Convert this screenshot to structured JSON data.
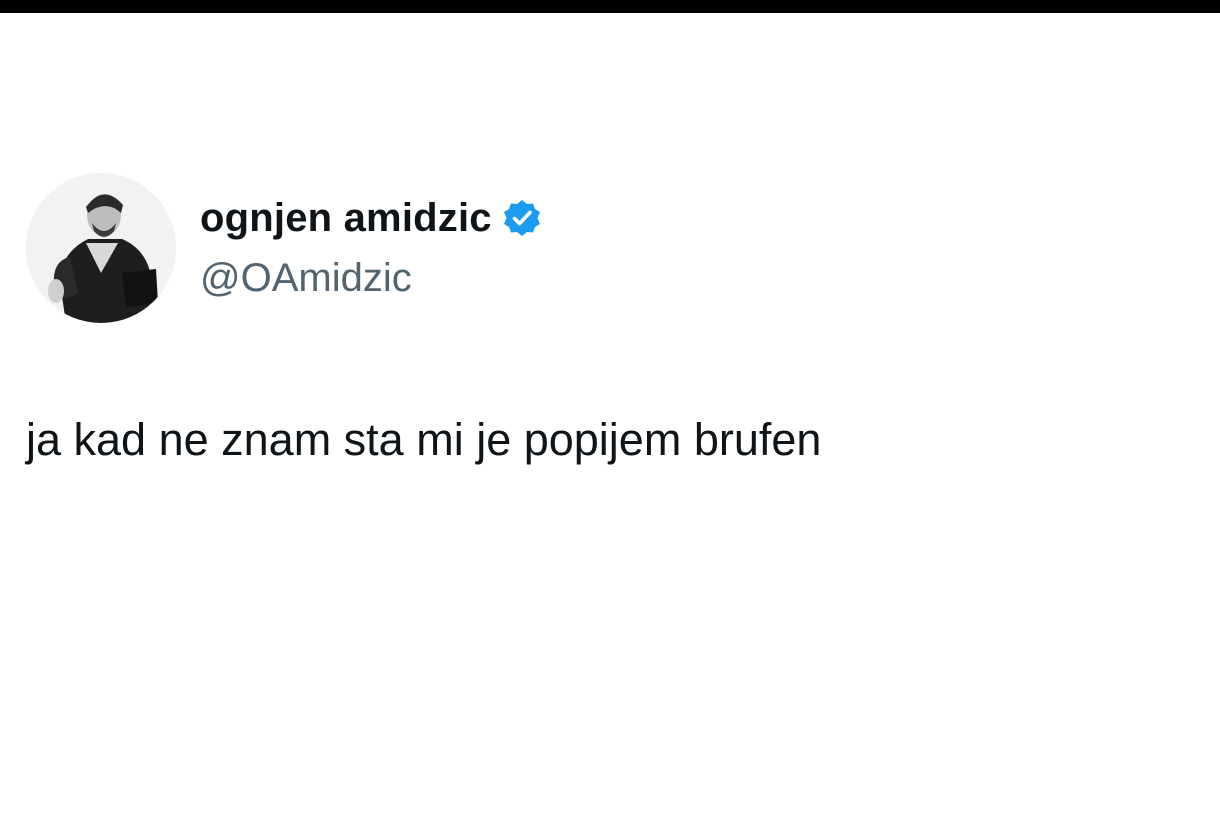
{
  "tweet": {
    "author": {
      "display_name": "ognjen amidzic",
      "handle": "@OAmidzic",
      "verified": true,
      "verified_badge_icon": "verified-badge-icon",
      "verified_color": "#1d9bf0",
      "avatar_icon": "profile-photo"
    },
    "text": "ja kad ne znam sta mi je popijem brufen"
  },
  "colors": {
    "top_bar": "#000000",
    "background": "#ffffff",
    "text_primary": "#0f1419",
    "text_secondary": "#536471"
  }
}
